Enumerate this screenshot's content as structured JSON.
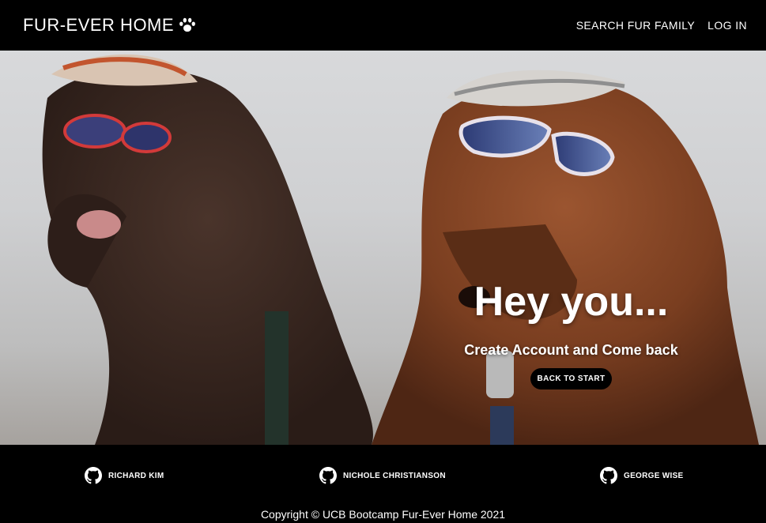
{
  "header": {
    "brand": "FUR-EVER HOME",
    "nav": [
      {
        "label": "SEARCH FUR FAMILY"
      },
      {
        "label": "LOG IN"
      }
    ]
  },
  "hero": {
    "title": "Hey you...",
    "subtitle": "Create Account and Come back",
    "button": "BACK TO START"
  },
  "footer": {
    "members": [
      {
        "name": "RICHARD KIM",
        "icon": "github-icon"
      },
      {
        "name": "NICHOLE CHRISTIANSON",
        "icon": "github-icon"
      },
      {
        "name": "GEORGE WISE",
        "icon": "github-icon"
      }
    ],
    "copyright": "Copyright © UCB Bootcamp Fur-Ever Home 2021"
  },
  "colors": {
    "header_bg": "#000000",
    "button_bg": "#000000",
    "text": "#ffffff"
  }
}
